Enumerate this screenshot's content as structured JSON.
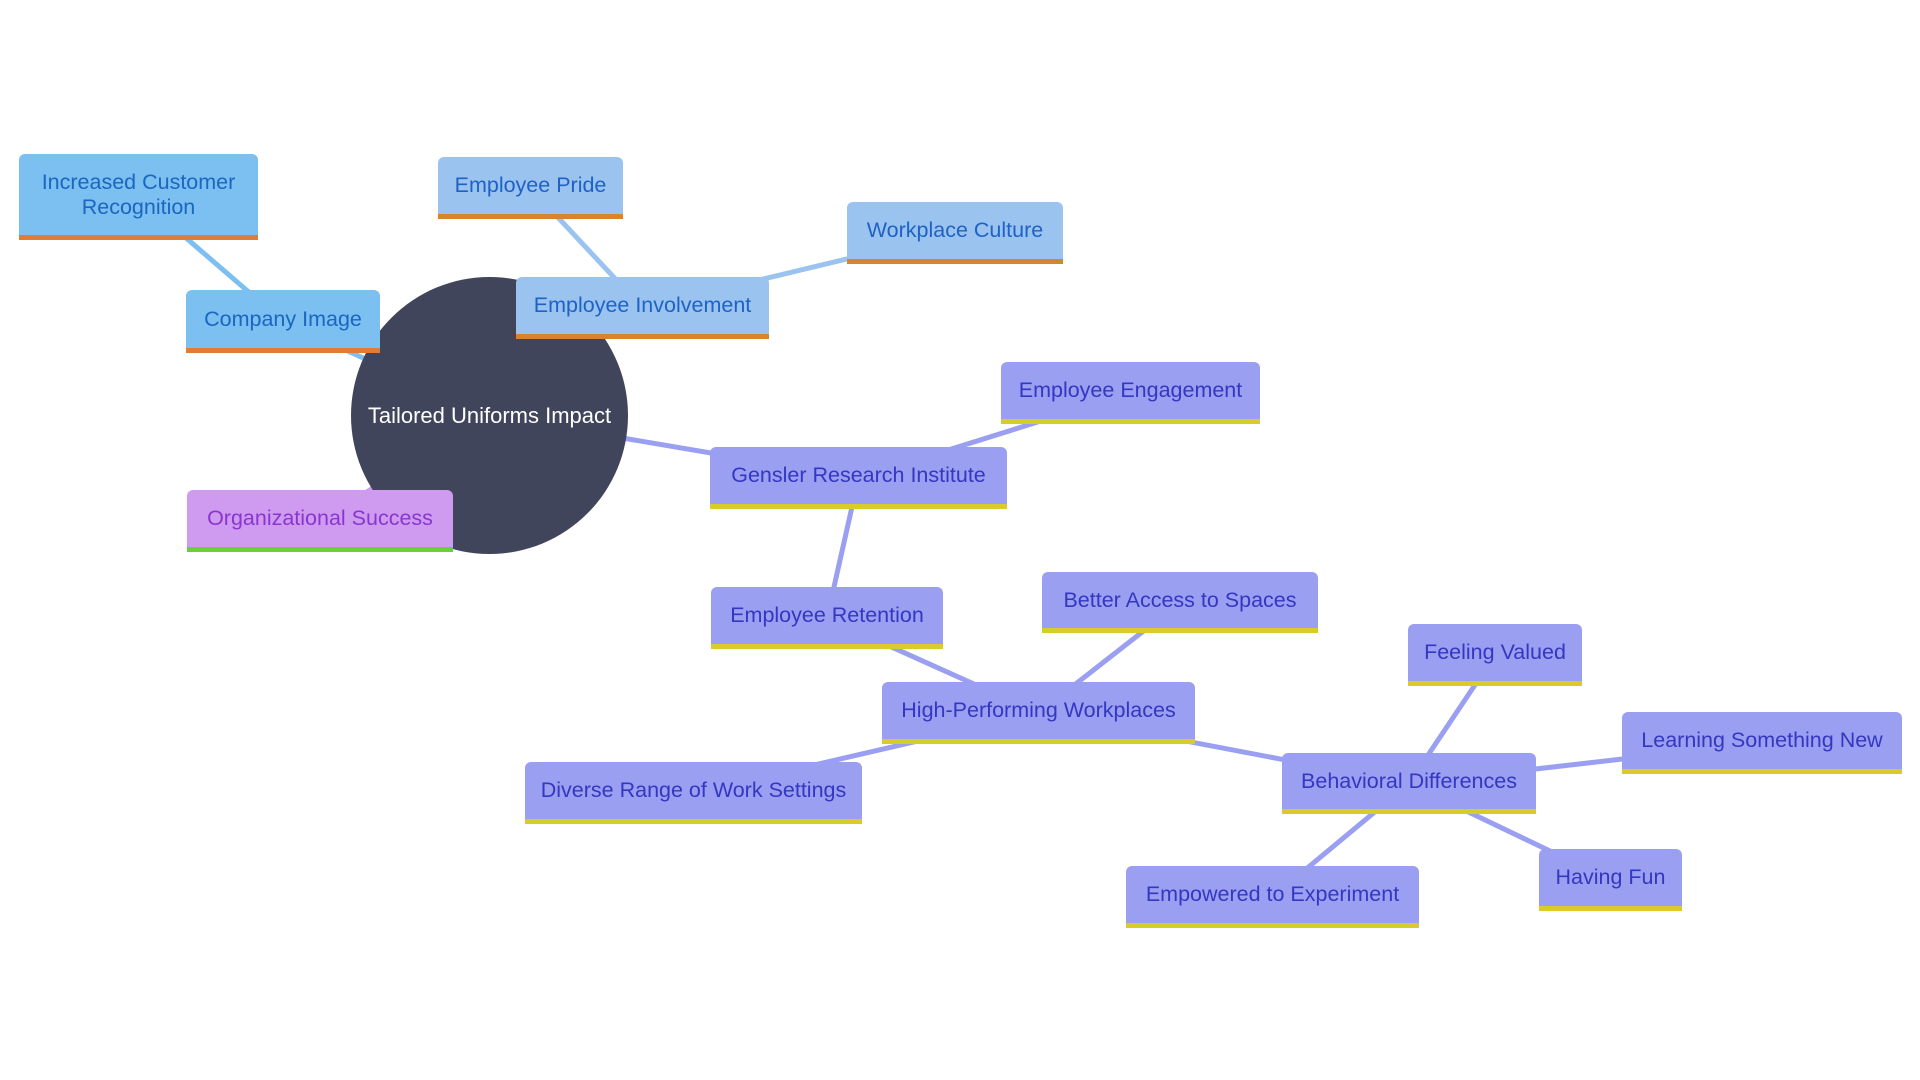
{
  "diagram": {
    "type": "mindmap",
    "root": {
      "id": "root",
      "label": "Tailored Uniforms Impact"
    },
    "nodes": [
      {
        "id": "company-image",
        "label": "Company Image",
        "parent": "root",
        "branch": "image"
      },
      {
        "id": "increased-customer-recognition",
        "label": "Increased Customer Recognition",
        "parent": "company-image",
        "branch": "image"
      },
      {
        "id": "employee-involvement",
        "label": "Employee Involvement",
        "parent": "root",
        "branch": "involve"
      },
      {
        "id": "employee-pride",
        "label": "Employee Pride",
        "parent": "employee-involvement",
        "branch": "involve"
      },
      {
        "id": "workplace-culture",
        "label": "Workplace Culture",
        "parent": "employee-involvement",
        "branch": "involve"
      },
      {
        "id": "organizational-success",
        "label": "Organizational Success",
        "parent": "root",
        "branch": "success"
      },
      {
        "id": "gensler-research-institute",
        "label": "Gensler Research Institute",
        "parent": "root",
        "branch": "gensler"
      },
      {
        "id": "employee-engagement",
        "label": "Employee Engagement",
        "parent": "gensler-research-institute",
        "branch": "gensler"
      },
      {
        "id": "employee-retention",
        "label": "Employee Retention",
        "parent": "gensler-research-institute",
        "branch": "gensler"
      },
      {
        "id": "high-performing-workplaces",
        "label": "High-Performing Workplaces",
        "parent": "employee-retention",
        "branch": "gensler"
      },
      {
        "id": "better-access-to-spaces",
        "label": "Better Access to Spaces",
        "parent": "high-performing-workplaces",
        "branch": "gensler"
      },
      {
        "id": "diverse-range-of-work-settings",
        "label": "Diverse Range of Work Settings",
        "parent": "high-performing-workplaces",
        "branch": "gensler"
      },
      {
        "id": "behavioral-differences",
        "label": "Behavioral Differences",
        "parent": "high-performing-workplaces",
        "branch": "gensler"
      },
      {
        "id": "feeling-valued",
        "label": "Feeling Valued",
        "parent": "behavioral-differences",
        "branch": "gensler"
      },
      {
        "id": "learning-something-new",
        "label": "Learning Something New",
        "parent": "behavioral-differences",
        "branch": "gensler"
      },
      {
        "id": "having-fun",
        "label": "Having Fun",
        "parent": "behavioral-differences",
        "branch": "gensler"
      },
      {
        "id": "empowered-to-experiment",
        "label": "Empowered to Experiment",
        "parent": "behavioral-differences",
        "branch": "gensler"
      }
    ],
    "colors": {
      "root_fill": "#41455c",
      "image_fill": "#7cbff1",
      "involve_fill": "#9ac3ef",
      "gensler_fill": "#9a9ff1",
      "success_fill": "#cf9bf1",
      "orange_accent": "#e07c38",
      "yellow_accent": "#d8cb2a",
      "green_accent": "#6bd031"
    }
  }
}
